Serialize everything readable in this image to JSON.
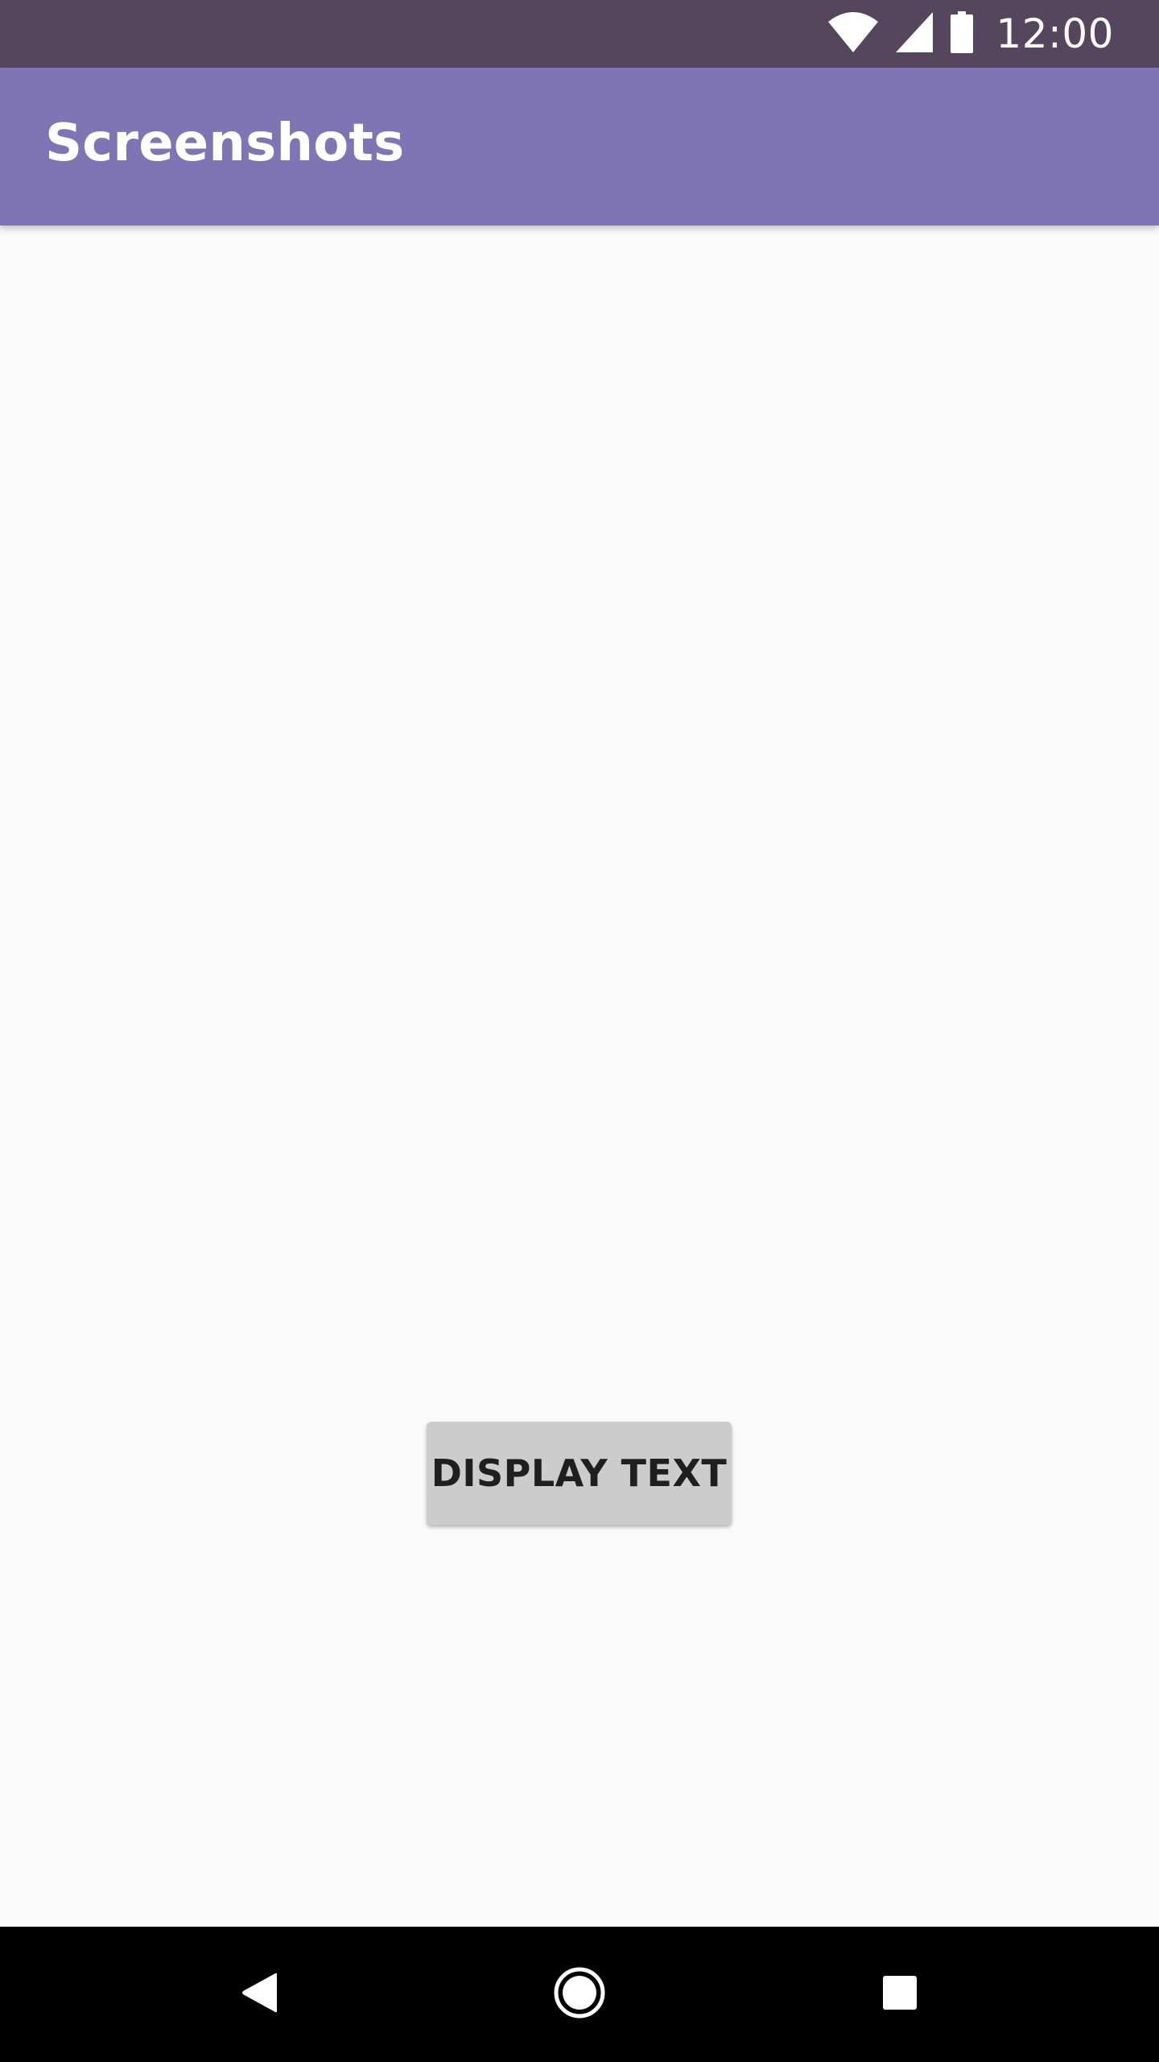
{
  "status_bar": {
    "time": "12:00",
    "icons": [
      "wifi-icon",
      "cellular-signal-icon",
      "battery-icon"
    ],
    "background": "#55455d"
  },
  "app_bar": {
    "title": "Screenshots",
    "background": "#7f74b4"
  },
  "main": {
    "display_button_label": "DISPLAY TEXT"
  },
  "nav_bar": {
    "icons": [
      "back-icon",
      "home-icon",
      "recents-icon"
    ]
  }
}
